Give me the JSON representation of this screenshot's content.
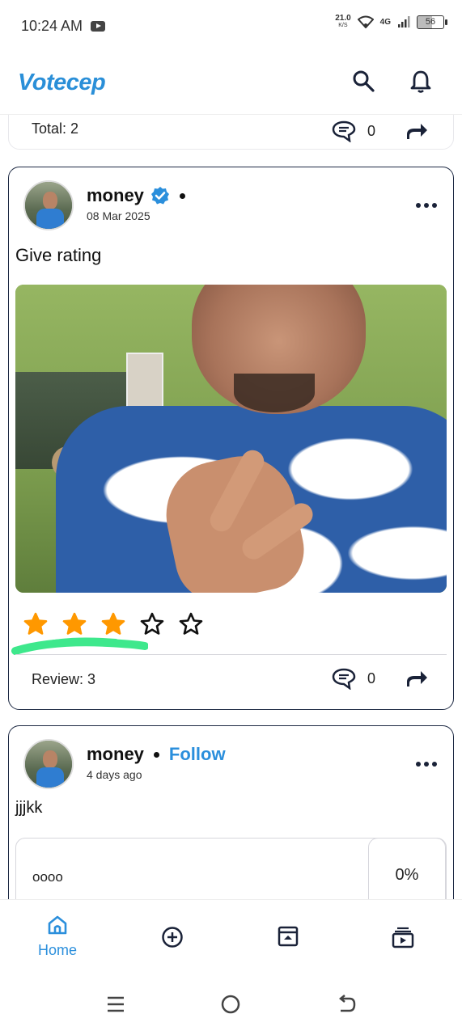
{
  "status_bar": {
    "time": "10:24 AM",
    "net_speed": "21.0",
    "net_unit": "K/S",
    "network": "4G",
    "battery": "56"
  },
  "header": {
    "logo": "Votecep",
    "search_icon": "search-icon",
    "bell_icon": "bell-icon"
  },
  "previous_post": {
    "total_label": "Total: 2",
    "comment_count": "0"
  },
  "post": {
    "author": "money",
    "date": "08 Mar 2025",
    "text": "Give rating",
    "rating": 3,
    "rating_max": 5,
    "review_label": "Review: 3",
    "comment_count": "0",
    "colors": {
      "star": "#ff9800",
      "verified": "#2b8fdc",
      "highlight": "#3ee88c"
    }
  },
  "next_post": {
    "author": "money",
    "follow_label": "Follow",
    "date": "4 days ago",
    "text": "jjjkk",
    "poll_option": "oooo",
    "poll_percent": "0%"
  },
  "bottom_nav": {
    "home_label": "Home",
    "accent": "#2b8fdc"
  }
}
